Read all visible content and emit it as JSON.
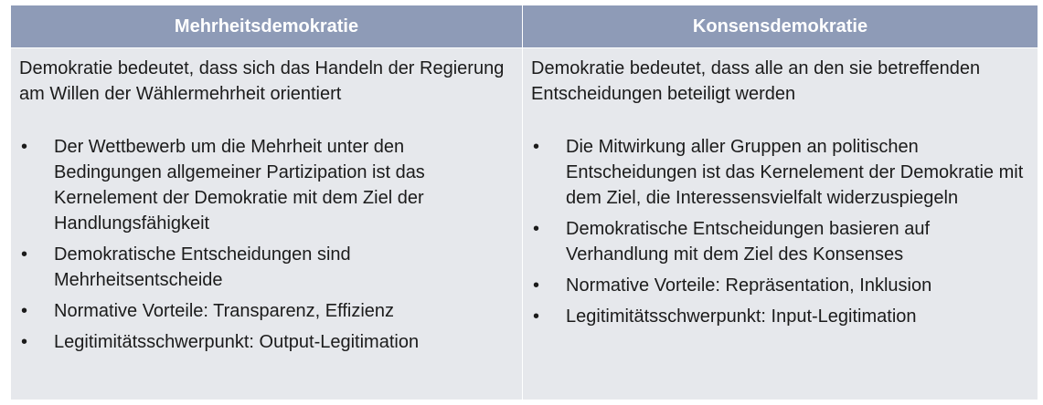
{
  "table": {
    "columns": [
      {
        "header": "Mehrheitsdemokratie",
        "intro": "Demokratie bedeutet, dass sich das Handeln der Regierung am Willen der Wählermehrheit orientiert",
        "bullets": [
          "Der Wettbewerb um die Mehrheit unter den Bedingungen allgemeiner Partizipation ist das Kernelement der Demokratie mit dem Ziel der Handlungsfähigkeit",
          "Demokratische Entscheidungen sind Mehrheitsentscheide",
          "Normative Vorteile: Transparenz, Effizienz",
          "Legitimitätsschwerpunkt: Output-Legitimation"
        ]
      },
      {
        "header": "Konsensdemokratie",
        "intro": "Demokratie bedeutet, dass alle an den sie betreffenden Entscheidungen beteiligt werden",
        "bullets": [
          "Die Mitwirkung aller Gruppen an politischen Entscheidungen ist das Kernelement der Demokratie mit dem Ziel, die Interessensvielfalt widerzuspiegeln",
          "Demokratische Entscheidungen basieren auf Verhandlung mit dem Ziel des Konsenses",
          "Normative Vorteile: Repräsentation, Inklusion",
          "Legitimitätsschwerpunkt: Input-Legitimation"
        ]
      }
    ],
    "bullet_symbol": "•",
    "colors": {
      "header_background": "#8e9bb7",
      "header_text": "#ffffff",
      "cell_background": "#e6e8ec",
      "body_text": "#1b1b1b"
    }
  }
}
